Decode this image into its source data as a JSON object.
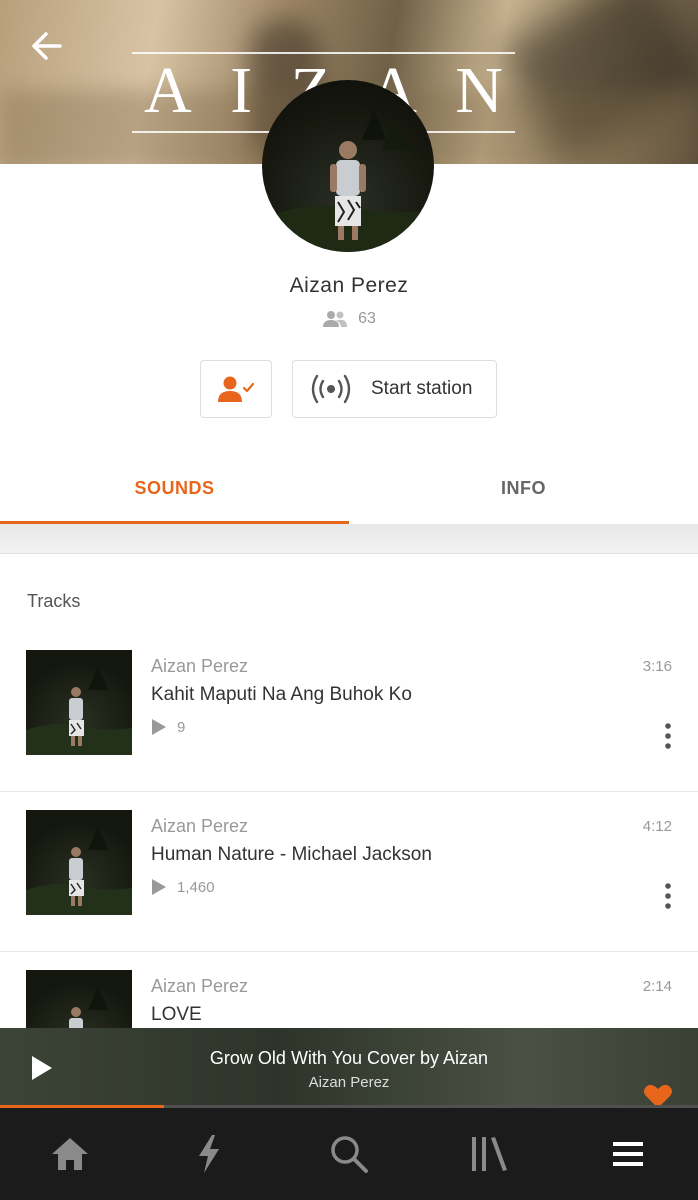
{
  "header": {
    "banner_text_letters": [
      "A",
      "I",
      "Z",
      "A",
      "N"
    ]
  },
  "profile": {
    "name": "Aizan Perez",
    "followers_count": "63"
  },
  "actions": {
    "start_station_label": "Start station"
  },
  "tabs": [
    {
      "label": "SOUNDS",
      "active": true
    },
    {
      "label": "INFO",
      "active": false
    }
  ],
  "tracks_section": {
    "title": "Tracks",
    "items": [
      {
        "artist": "Aizan Perez",
        "title": "Kahit Maputi Na Ang Buhok Ko",
        "plays": "9",
        "duration": "3:16"
      },
      {
        "artist": "Aizan Perez",
        "title": "Human Nature - Michael Jackson",
        "plays": "1,460",
        "duration": "4:12"
      },
      {
        "artist": "Aizan Perez",
        "title": "LOVE",
        "plays": "",
        "duration": "2:14"
      }
    ]
  },
  "player": {
    "title": "Grow Old With You Cover by Aizan",
    "artist": "Aizan Perez",
    "progress_percent": 23.5
  },
  "bottom_nav": {
    "items": [
      "home-icon",
      "stream-icon",
      "search-icon",
      "library-icon",
      "menu-icon"
    ]
  },
  "colors": {
    "accent": "#e8661c",
    "nav_background": "#1b1b1b"
  }
}
